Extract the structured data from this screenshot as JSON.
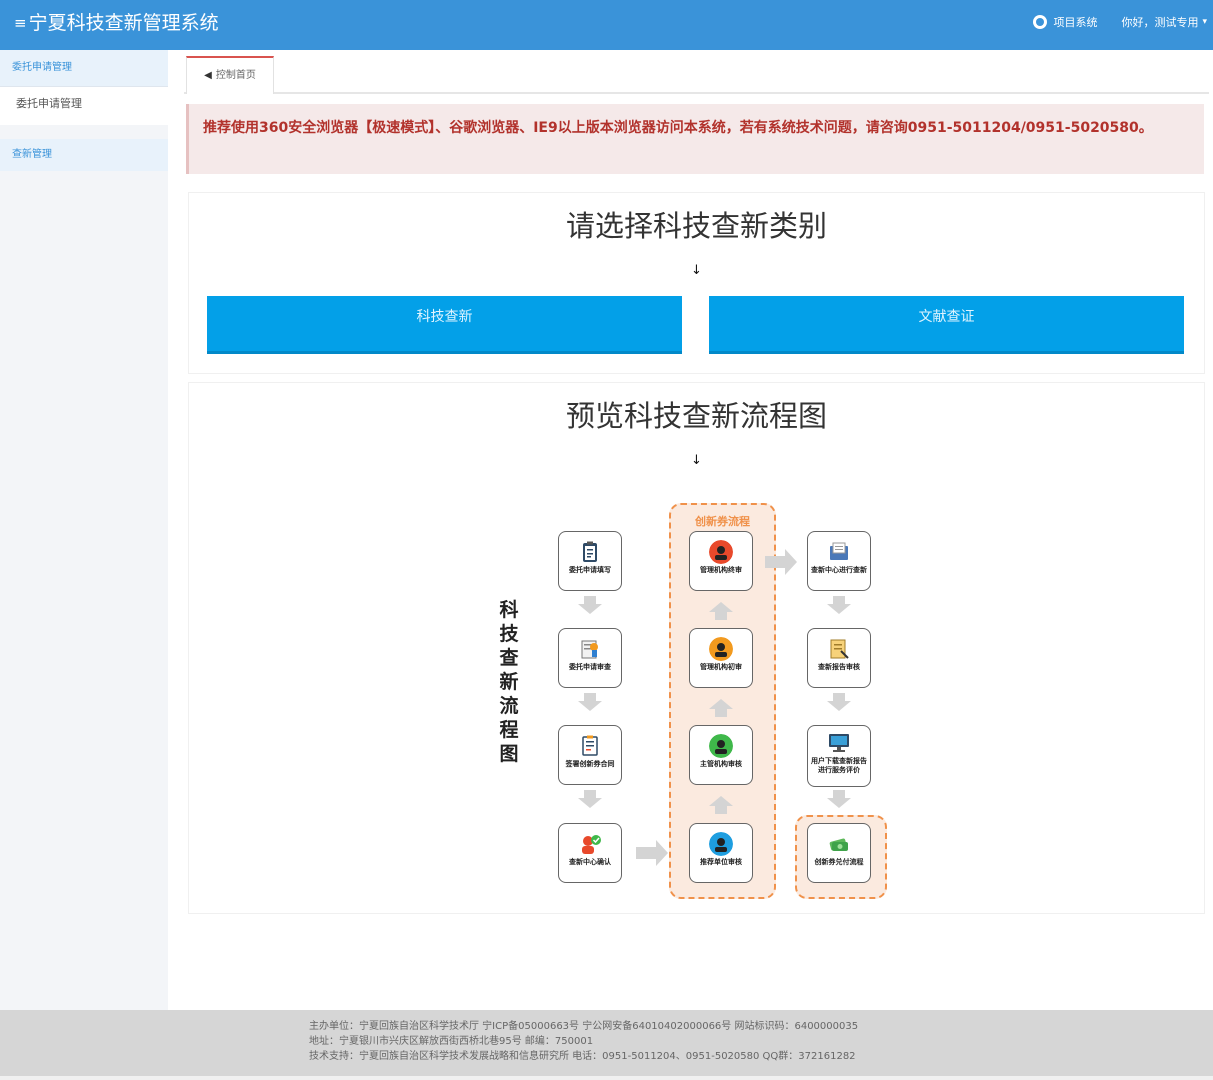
{
  "header": {
    "title": "宁夏科技查新管理系统",
    "menu_icon": "menu-icon",
    "projects_label": "项目系统",
    "user_label": "你好，测试专用"
  },
  "sidebar": {
    "group1": "委托申请管理",
    "items": [
      {
        "label": "委托申请管理"
      }
    ],
    "group2": "查新管理"
  },
  "tabs": [
    {
      "label": "控制首页"
    }
  ],
  "alert": {
    "text": "推荐使用360安全浏览器【极速模式】、谷歌浏览器、IE9以上版本浏览器访问本系统，若有系统技术问题，请咨询0951-5011204/0951-5020580。"
  },
  "category": {
    "title": "请选择科技查新类别",
    "arrow": "↓",
    "buttons": [
      {
        "label": "科技查新"
      },
      {
        "label": "文献查证"
      }
    ]
  },
  "flow": {
    "title": "预览科技查新流程图",
    "arrow": "↓",
    "vertical_title": "科技查新流程图",
    "group_label": "创新券流程",
    "left_nodes": [
      {
        "label": "委托申请填写",
        "icon": "clipboard-icon"
      },
      {
        "label": "委托申请审查",
        "icon": "document-review-icon"
      },
      {
        "label": "签署创新券合同",
        "icon": "contract-icon"
      },
      {
        "label": "查新中心确认",
        "icon": "confirm-user-icon"
      }
    ],
    "middle_nodes": [
      {
        "label": "管理机构终审",
        "icon": "user-red-icon",
        "color": "#e8492b"
      },
      {
        "label": "管理机构初审",
        "icon": "user-orange-icon",
        "color": "#f29a1f"
      },
      {
        "label": "主管机构审核",
        "icon": "user-green-icon",
        "color": "#3fb84a"
      },
      {
        "label": "推荐单位审核",
        "icon": "user-blue-icon",
        "color": "#1e9ee0"
      }
    ],
    "right_nodes": [
      {
        "label": "查新中心进行查新",
        "icon": "folder-icon"
      },
      {
        "label": "查新报告审核",
        "icon": "report-icon"
      },
      {
        "label": "用户下载查新报告进行服务评价",
        "icon": "monitor-icon"
      },
      {
        "label": "创新券兑付流程",
        "icon": "money-icon"
      }
    ]
  },
  "footer": {
    "line1": "主办单位：宁夏回族自治区科学技术厅    宁ICP备05000663号 宁公网安备64010402000066号 网站标识码：6400000035",
    "line2": "地址：宁夏银川市兴庆区解放西街西桥北巷95号    邮编：750001",
    "line3": "技术支持：宁夏回族自治区科学技术发展战略和信息研究所    电话：0951-5011204、0951-5020580    QQ群：372161282"
  },
  "colors": {
    "header_bg": "#3a93d9",
    "button_bg": "#03a0e8",
    "alert_text": "#b2322c",
    "flow_accent": "#f0914a"
  }
}
